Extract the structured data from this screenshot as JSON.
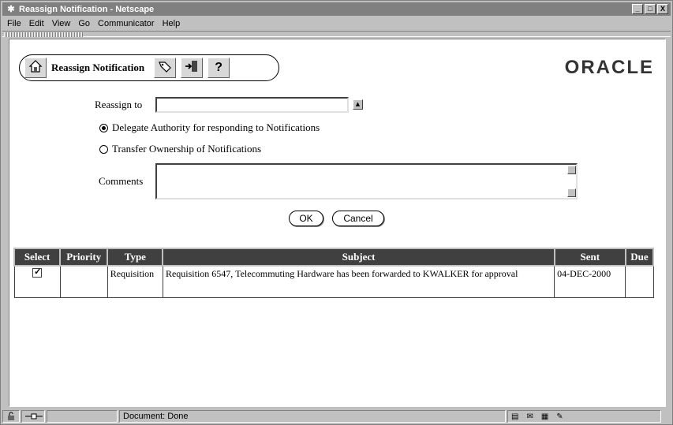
{
  "window": {
    "title": "Reassign Notification - Netscape",
    "controls": [
      "_",
      "□",
      "X"
    ]
  },
  "menu": [
    "File",
    "Edit",
    "View",
    "Go",
    "Communicator",
    "Help"
  ],
  "toolbar": {
    "title": "Reassign Notification",
    "help_glyph": "?"
  },
  "brand": "ORACLE",
  "form": {
    "reassign_label": "Reassign to",
    "reassign_value": "",
    "option_delegate": "Delegate Authority for responding to Notifications",
    "option_transfer": "Transfer Ownership of Notifications",
    "comments_label": "Comments",
    "comments_value": "",
    "ok_label": "OK",
    "cancel_label": "Cancel"
  },
  "table": {
    "headers": [
      "Select",
      "Priority",
      "Type",
      "Subject",
      "Sent",
      "Due"
    ],
    "rows": [
      {
        "select": "checked",
        "priority": "",
        "type": "Requisition",
        "subject": "Requisition 6547, Telecommuting Hardware has been forwarded to KWALKER for approval",
        "sent": "04-DEC-2000",
        "due": ""
      }
    ]
  },
  "status": {
    "text": "Document: Done"
  }
}
